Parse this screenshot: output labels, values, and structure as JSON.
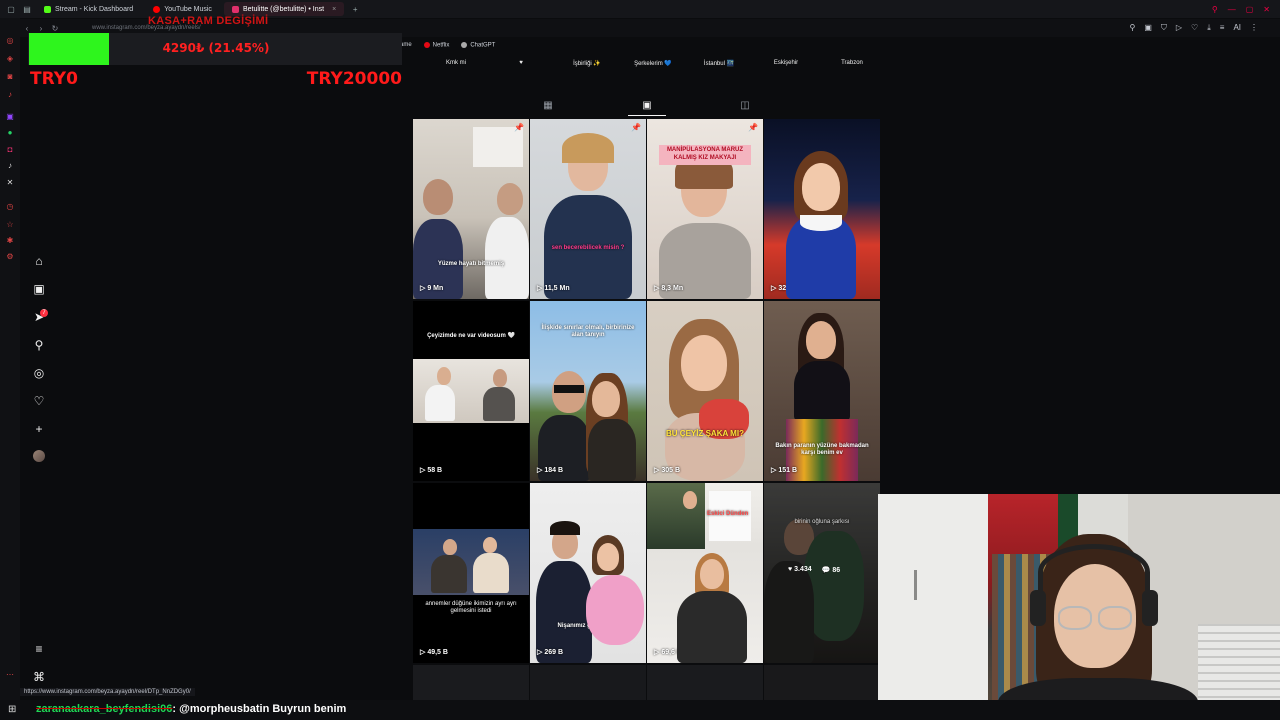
{
  "browser": {
    "tabs": [
      {
        "label": "Stream - Kick Dashboard",
        "color": "#53fc18"
      },
      {
        "label": "YouTube Music",
        "color": "#ff0000"
      },
      {
        "label": "Betulitte (@betulitte) • Inst",
        "color": "#e1306c",
        "active": true
      }
    ],
    "url": "www.instagram.com/beyza.ayaydn/reels/",
    "bookmarks": [
      {
        "label": "ame",
        "color": "#888"
      },
      {
        "label": "Netflix",
        "color": "#e50914"
      },
      {
        "label": "ChatGPT",
        "color": "#aaaaaa"
      }
    ],
    "ai_label": "AI"
  },
  "overlay": {
    "kasa_label": "KASA+RAM DEGİŞİMİ",
    "progress_text": "4290₺ (21.45%)",
    "progress_fraction": 0.2145,
    "goal_start": "TRY0",
    "goal_end": "TRY20000"
  },
  "highlights": [
    "Kmk mi",
    "♥",
    "İşbirliği ✨",
    "Şerkelerim 💙",
    "İstanbul 🌃",
    "Eskişehir",
    "Trabzon"
  ],
  "reels": [
    {
      "views": "9 Mn",
      "pinned": true,
      "caption": "Yüzme hayatı bitmemiş",
      "bg": [
        "#d9d4cc",
        "#5a5550"
      ]
    },
    {
      "views": "11,5 Mn",
      "pinned": true,
      "caption": "sen becerebilicek misin ?",
      "bg": [
        "#cfd3d6",
        "#2a3a55"
      ]
    },
    {
      "views": "8,3 Mn",
      "pinned": true,
      "tag": "MANİPÜLASYONA MARUZ KALMIŞ KIZ MAKYAJI",
      "bg": [
        "#e8e0d8",
        "#b89e8a"
      ]
    },
    {
      "views": "32 B",
      "pinned": false,
      "bg": [
        "#0d1530",
        "#2346a8"
      ]
    },
    {
      "views": "58 B",
      "pinned": false,
      "caption": "Çeyizimde ne var videosum 🤍",
      "bg": [
        "#000000",
        "#000000"
      ]
    },
    {
      "views": "184 B",
      "pinned": false,
      "caption": "İlişkide sınırlar olmalı, birbirinize alan tanıyın",
      "bg": [
        "#7fb2de",
        "#3a3128"
      ]
    },
    {
      "views": "305 B",
      "pinned": false,
      "caption": "BU ÇEYİZ ŞAKA MI?",
      "bg": [
        "#cfc5b8",
        "#7a5a48"
      ]
    },
    {
      "views": "151 B",
      "pinned": false,
      "caption": "Bakın paranın yüzüne bakmadan karşı benim ev",
      "bg": [
        "#6a5548",
        "#2a1e20"
      ]
    },
    {
      "views": "49,5 B",
      "pinned": false,
      "caption": "annemler düğüne ikimizin ayrı ayrı gelmesini istedi",
      "bg": [
        "#000000",
        "#000000"
      ]
    },
    {
      "views": "269 B",
      "pinned": false,
      "caption": "Nişanımız gerçekleşti",
      "bg": [
        "#ececec",
        "#1d2233"
      ]
    },
    {
      "views": "69,6 B",
      "pinned": false,
      "caption": "Eskici Dünden",
      "bg": [
        "#e8e6e2",
        "#2a2a2a"
      ]
    },
    {
      "hover": true,
      "likes": "3.434",
      "comments": "86",
      "caption": "birinin oğluna şarkısı",
      "bg": [
        "#4a4a48",
        "#1e2a22"
      ]
    }
  ],
  "status_url": "https://www.instagram.com/beyza.ayaydn/reel/DTp_NnZDGy0/",
  "chat": {
    "user": "zaranaakara_beyfendisi06",
    "message": "@morpheusbatin Buyrun benim"
  }
}
